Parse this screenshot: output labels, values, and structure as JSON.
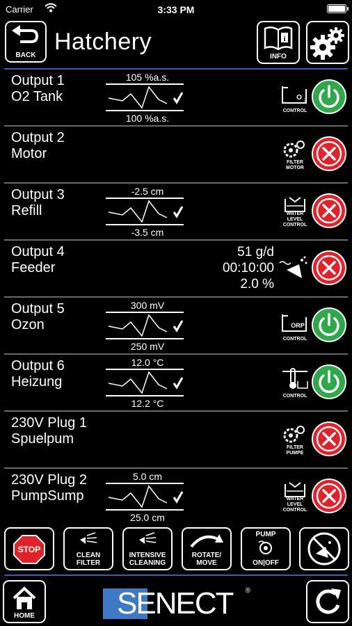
{
  "status_bar": {
    "carrier": "Carrier",
    "time": "3:33 PM"
  },
  "header": {
    "back_label": "BACK",
    "title": "Hatchery",
    "info_label": "INFO"
  },
  "outputs": [
    {
      "name": "Output 1",
      "sub": "O2 Tank",
      "top": "105 %a.s.",
      "bottom": "100 %a.s.",
      "function_label": "CONTROL",
      "function_icon": "o2-control-icon",
      "state": "on"
    },
    {
      "name": "Output 2",
      "sub": "Motor",
      "function_label": "FILTER MOTOR",
      "function_icon": "filter-motor-icon",
      "state": "off"
    },
    {
      "name": "Output 3",
      "sub": "Refill",
      "top": "-2.5 cm",
      "bottom": "-3.5 cm",
      "function_label": "WATER LEVEL CONTROL",
      "function_icon": "water-level-control-icon",
      "state": "off"
    },
    {
      "name": "Output 4",
      "sub": "Feeder",
      "feed_rate": "51 g/d",
      "feed_time": "00:10:00",
      "feed_pct": "2.0 %",
      "function_icon": "feeder-icon",
      "state": "off"
    },
    {
      "name": "Output 5",
      "sub": "Ozon",
      "top": "300 mV",
      "bottom": "250 mV",
      "function_label": "CONTROL",
      "function_icon": "orp-control-icon",
      "state": "on"
    },
    {
      "name": "Output 6",
      "sub": "Heizung",
      "top": "12.0 °C",
      "bottom": "12.2 °C",
      "function_label": "CONTROL",
      "function_icon": "temp-control-icon",
      "state": "on"
    },
    {
      "name": "230V Plug 1",
      "sub": "Spuelpum",
      "function_label": "FILTER PUMPE",
      "function_icon": "filter-pump-icon",
      "state": "off"
    },
    {
      "name": "230V Plug 2",
      "sub": "PumpSump",
      "top": "5.0 cm",
      "bottom": "25.0 cm",
      "function_label": "WATER LEVEL CONTROL",
      "function_icon": "water-level-control-icon",
      "state": "off"
    }
  ],
  "actions": {
    "stop": "STOP",
    "clean_filter_1": "CLEAN",
    "clean_filter_2": "FILTER",
    "intensive_1": "INTENSIVE",
    "intensive_2": "CLEANING",
    "rotate_1": "ROTATE/",
    "rotate_2": "MOVE",
    "pump_top": "PUMP",
    "pump_bottom": "ON|OFF"
  },
  "footer": {
    "home_label": "HOME",
    "logo": "SENECT",
    "logo_reg": "®"
  },
  "colors": {
    "accent_line": "#3d5db8",
    "on": "#2ea84a",
    "off": "#e0222a"
  }
}
